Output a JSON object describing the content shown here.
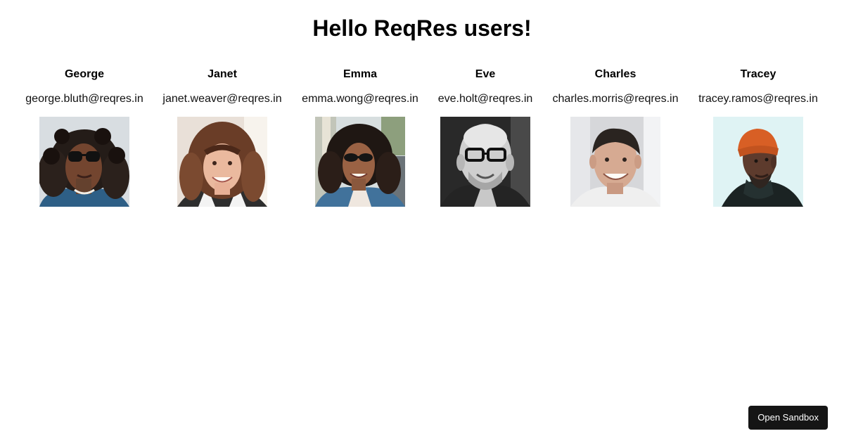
{
  "page": {
    "title": "Hello ReqRes users!"
  },
  "users": [
    {
      "name": "George",
      "email": "george.bluth@reqres.in",
      "avatar_icon": "portrait-curly-hair-sunglasses"
    },
    {
      "name": "Janet",
      "email": "janet.weaver@reqres.in",
      "avatar_icon": "portrait-long-wavy-hair"
    },
    {
      "name": "Emma",
      "email": "emma.wong@reqres.in",
      "avatar_icon": "portrait-curly-hair-sunglasses-street"
    },
    {
      "name": "Eve",
      "email": "eve.holt@reqres.in",
      "avatar_icon": "portrait-bald-glasses-grayscale"
    },
    {
      "name": "Charles",
      "email": "charles.morris@reqres.in",
      "avatar_icon": "portrait-short-hair-smiling"
    },
    {
      "name": "Tracey",
      "email": "tracey.ramos@reqres.in",
      "avatar_icon": "portrait-orange-beanie"
    }
  ],
  "sandbox": {
    "label": "Open Sandbox"
  },
  "colors": {
    "background": "#ffffff",
    "text": "#000000",
    "button_background": "#151515",
    "button_text": "#ffffff"
  }
}
